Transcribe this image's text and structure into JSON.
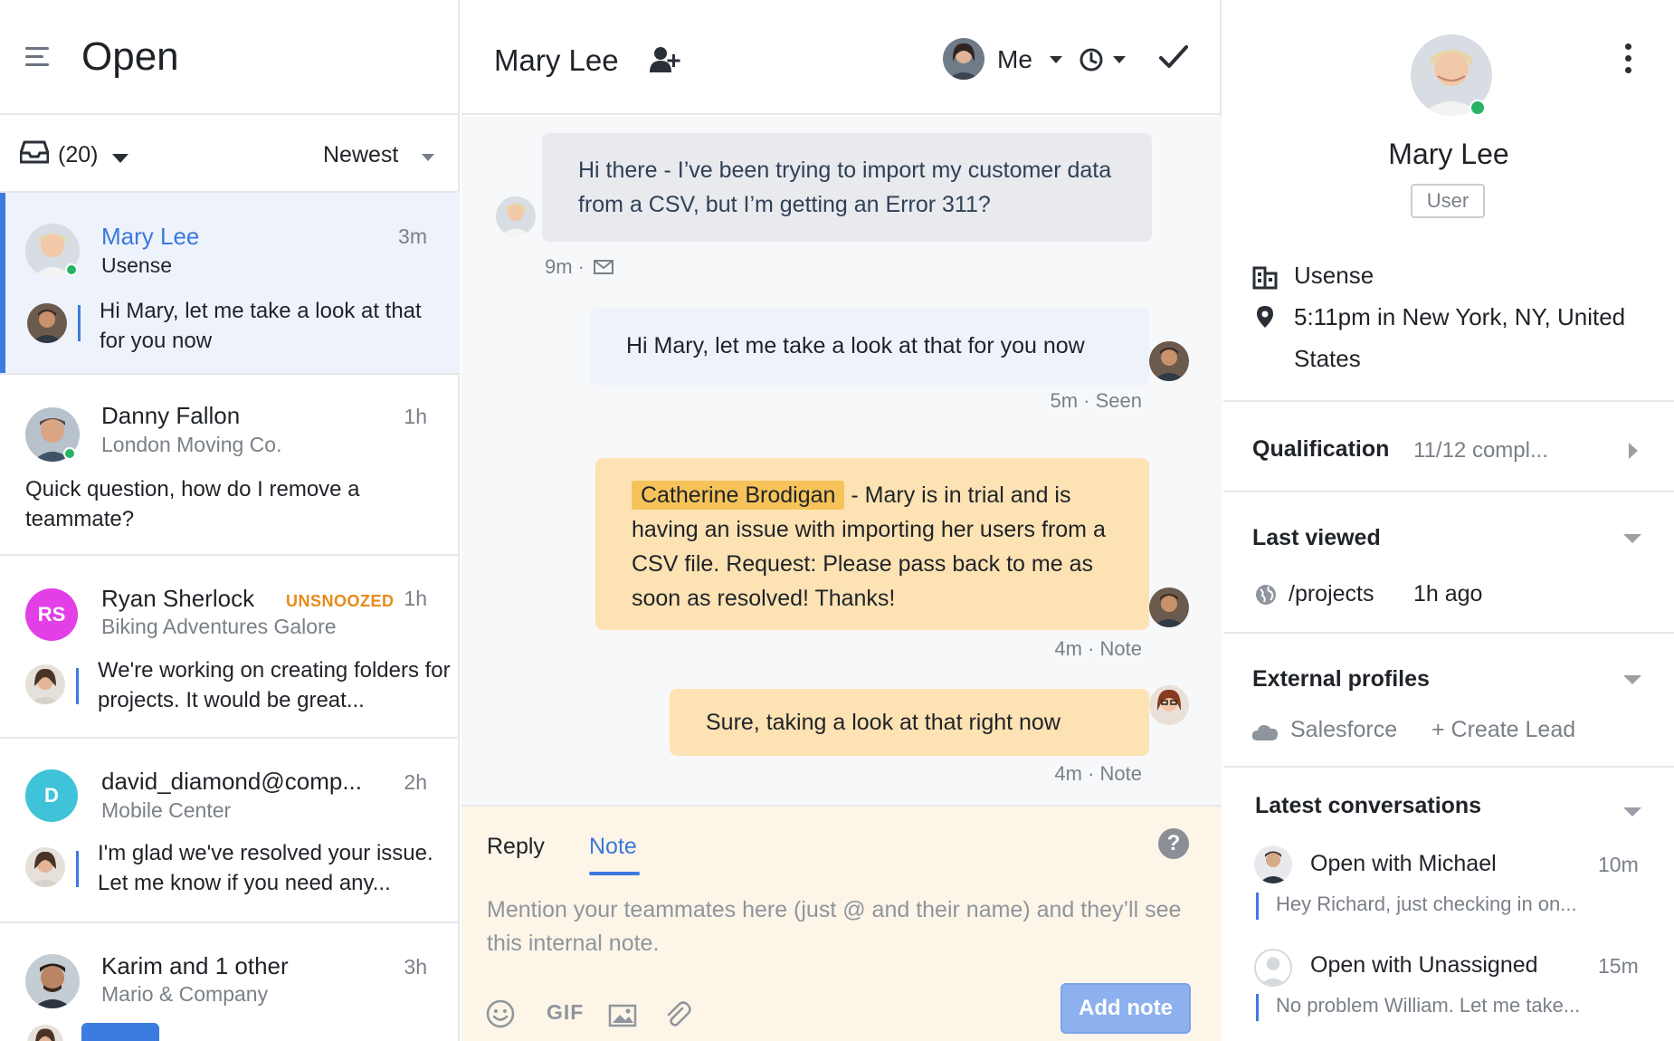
{
  "inbox": {
    "title": "Open",
    "count_label": "(20)",
    "sort_label": "Newest",
    "conversations": [
      {
        "name": "Mary Lee",
        "company": "Usense",
        "time": "3m",
        "preview": "Hi Mary, let me take a look at that for you now"
      },
      {
        "name": "Danny Fallon",
        "company": "London Moving Co.",
        "time": "1h",
        "preview": "Quick question, how do I remove a teammate?"
      },
      {
        "name": "Ryan Sherlock",
        "badge": "UNSNOOZED",
        "company": "Biking Adventures Galore",
        "time": "1h",
        "initials": "RS",
        "preview": "We're working on creating folders for projects. It would be great..."
      },
      {
        "name": "david_diamond@comp...",
        "company": "Mobile Center",
        "time": "2h",
        "initials": "D",
        "preview": "I'm glad we've resolved your issue. Let me know if you need any..."
      },
      {
        "name": "Karim and 1 other",
        "company": "Mario & Company",
        "time": "3h"
      }
    ]
  },
  "thread": {
    "title": "Mary Lee",
    "assignee": "Me",
    "messages": [
      {
        "text": "Hi there - I’ve been trying to import my customer data from a CSV, but I’m getting an Error 311?",
        "meta": "9m ·"
      },
      {
        "text": "Hi Mary, let me take a look at that for you now",
        "meta": "5m · Seen"
      },
      {
        "mention": "Catherine Brodigan",
        "text": " - Mary is in trial and is having an issue with importing her users from a CSV file. Request: Please pass back to me as soon as resolved! Thanks!",
        "meta": "4m ·  Note"
      },
      {
        "text": "Sure, taking a look at that right now",
        "meta": "4m ·  Note"
      }
    ]
  },
  "composer": {
    "tab_reply": "Reply",
    "tab_note": "Note",
    "help": "?",
    "placeholder": "Mention your teammates here (just @ and their name) and they’ll see this internal note.",
    "gif": "GIF",
    "add_note": "Add note"
  },
  "profile": {
    "name": "Mary Lee",
    "role": "User",
    "company": "Usense",
    "location": "5:11pm in New York, NY, United States",
    "qualification_title": "Qualification",
    "qualification_value": "11/12 compl...",
    "last_viewed_title": "Last viewed",
    "last_viewed_page": "/projects",
    "last_viewed_time": "1h ago",
    "external_title": "External profiles",
    "salesforce": "Salesforce",
    "create_lead": "+ Create Lead",
    "latest_title": "Latest conversations",
    "latest": [
      {
        "title": "Open with Michael",
        "time": "10m",
        "preview": "Hey Richard, just checking in on..."
      },
      {
        "title": "Open with Unassigned",
        "time": "15m",
        "preview": "No problem William. Let me take..."
      }
    ]
  },
  "colors": {
    "accent": "#3b78dd",
    "note_bg": "#fde2b3",
    "mention_bg": "#f6c35a",
    "presence": "#28b463",
    "unsnoozed": "#e88a1a",
    "ryan_avatar": "#e23fe7",
    "david_avatar": "#3fc3d8"
  },
  "icons": [
    "hamburger-icon",
    "inbox-icon",
    "add-user-icon",
    "clock-icon",
    "check-icon",
    "help-icon",
    "emoji-icon",
    "image-icon",
    "attachment-icon",
    "kebab-icon",
    "building-icon",
    "location-pin-icon",
    "globe-icon",
    "salesforce-cloud-icon"
  ]
}
